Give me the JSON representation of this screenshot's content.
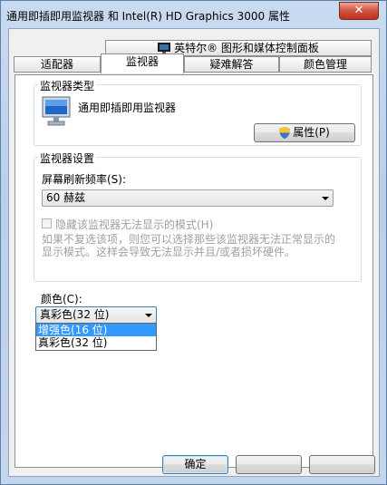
{
  "window": {
    "title": "通用即插即用监视器 和 Intel(R) HD Graphics 3000 属性",
    "close_glyph": "✕"
  },
  "tabs_top": [
    {
      "label": "英特尔® 图形和媒体控制面板"
    }
  ],
  "tabs": [
    {
      "label": "适配器",
      "active": false
    },
    {
      "label": "监视器",
      "active": true
    },
    {
      "label": "疑难解答",
      "active": false
    },
    {
      "label": "颜色管理",
      "active": false
    }
  ],
  "monitor_type": {
    "group_label": "监视器类型",
    "name": "通用即插即用监视器",
    "properties_button": "属性(P)"
  },
  "monitor_settings": {
    "group_label": "监视器设置",
    "refresh_label": "屏幕刷新频率(S):",
    "refresh_value": "60 赫兹",
    "hide_modes_label": "隐藏该监视器无法显示的模式(H)",
    "hide_modes_checked": false,
    "help_line1": "如果不复选该项，则您可以选择那些该监视器无法正常显示的",
    "help_line2": "显示模式。这样会导致无法显示并且/或者损坏硬件。"
  },
  "colors": {
    "label": "颜色(C):",
    "selected_value": "真彩色(32 位)",
    "options": [
      {
        "label": "增强色(16 位)",
        "highlighted": true
      },
      {
        "label": "真彩色(32 位)",
        "highlighted": false
      }
    ]
  },
  "footer": {
    "ok_button": "确定",
    "cancel_button": "",
    "apply_button": ""
  },
  "colors_theme": {
    "accent": "#3399ff",
    "close": "#c0301c"
  }
}
